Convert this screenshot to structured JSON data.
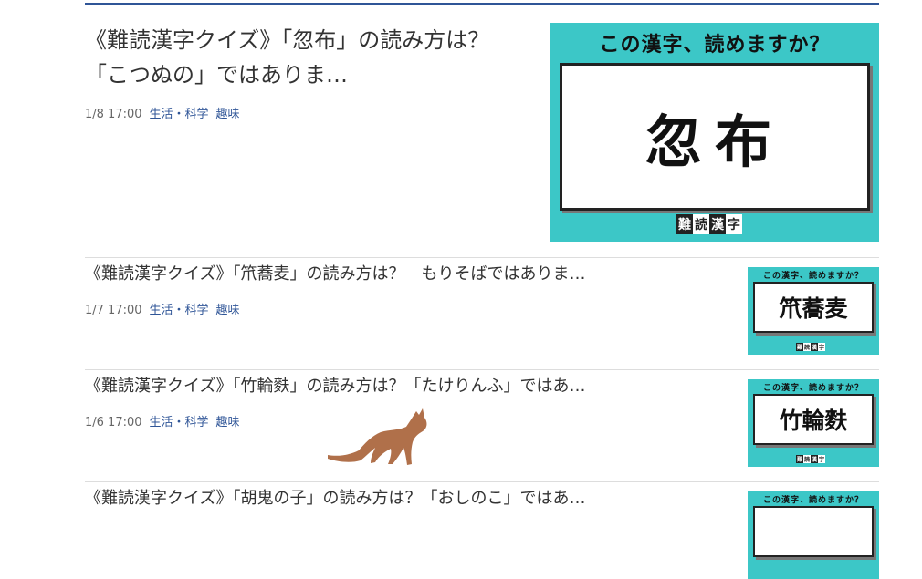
{
  "articles": [
    {
      "title": "《難読漢字クイズ》「忽布」の読み方は？「こつぬの」ではありま…",
      "date": "1/8 17:00",
      "categories": [
        "生活・科学",
        "趣味"
      ],
      "thumb": {
        "question": "この漢字、読めますか？",
        "kanji": "忽布",
        "badge": [
          "難",
          "読",
          "漢",
          "字"
        ]
      }
    },
    {
      "title": "《難読漢字クイズ》「笊蕎麦」の読み方は？　もりそばではありま…",
      "date": "1/7 17:00",
      "categories": [
        "生活・科学",
        "趣味"
      ],
      "thumb": {
        "question": "この漢字、読めますか？",
        "kanji": "笊蕎麦",
        "badge": [
          "難",
          "読",
          "漢",
          "字"
        ]
      }
    },
    {
      "title": "《難読漢字クイズ》「竹輪麩」の読み方は？「たけりんふ」ではあ…",
      "date": "1/6 17:00",
      "categories": [
        "生活・科学",
        "趣味"
      ],
      "thumb": {
        "question": "この漢字、読めますか？",
        "kanji": "竹輪麩",
        "badge": [
          "難",
          "読",
          "漢",
          "字"
        ]
      }
    },
    {
      "title": "《難読漢字クイズ》「胡鬼の子」の読み方は？「おしのこ」ではあ…",
      "thumb": {
        "question": "この漢字、読めますか？"
      }
    }
  ],
  "colors": {
    "rule": "#2f5597",
    "category_link": "#2f5597",
    "thumb_bg": "#3cc7c7",
    "cat": "#b0704a"
  },
  "icons": {
    "overlay": "cat-silhouette-icon"
  }
}
